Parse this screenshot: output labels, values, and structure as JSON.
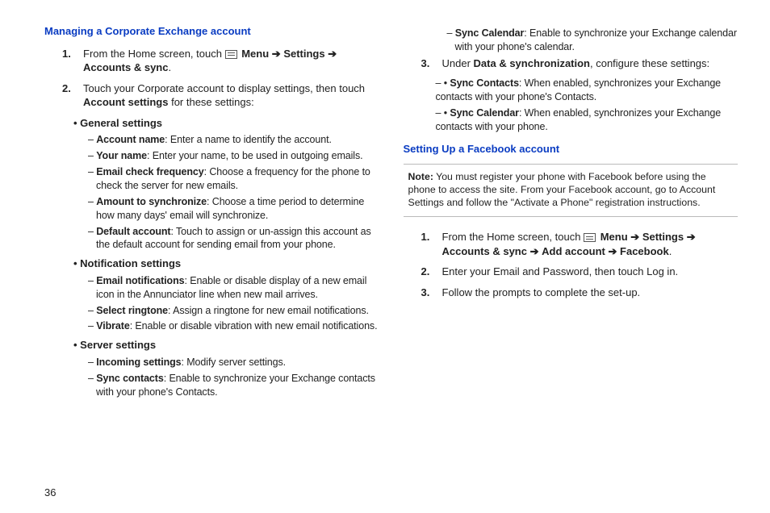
{
  "leftCol": {
    "heading": "Managing a Corporate Exchange account",
    "step1_pre": "From the Home screen, touch ",
    "step1_menu": "Menu",
    "step1_arrow": " ➔ ",
    "step1_settings": "Settings",
    "step1_arrow2": " ➔ ",
    "step1_accounts": "Accounts & sync",
    "step1_period": ".",
    "step2_a": "Touch your Corporate account to display settings, then touch ",
    "step2_b": "Account settings",
    "step2_c": " for these settings:",
    "general_heading": "General settings",
    "g1_b": "Account name",
    "g1_t": ": Enter a name to identify the account.",
    "g2_b": "Your name",
    "g2_t": ": Enter your name, to be used in outgoing emails.",
    "g3_b": "Email check frequency",
    "g3_t": ": Choose a frequency for the phone to check the server for new emails.",
    "g4_b": "Amount to synchronize",
    "g4_t": ": Choose a time period to determine how many days' email will synchronize.",
    "g5_b": "Default account",
    "g5_t": ": Touch to assign or un-assign this account as the default account for sending email from your phone.",
    "notif_heading": "Notification settings",
    "n1_b": "Email notifications",
    "n1_t": ": Enable or disable display of a new email icon in the Annunciator line when new mail arrives.",
    "n2_b": "Select ringtone",
    "n2_t": ": Assign a ringtone for new email notifications.",
    "n3_b": "Vibrate",
    "n3_t": ": Enable or disable vibration with new email notifications.",
    "server_heading": "Server settings",
    "s1_b": "Incoming settings",
    "s1_t": ": Modify server settings.",
    "s2_b": "Sync contacts",
    "s2_t": ": Enable to synchronize your Exchange contacts with your phone's Contacts."
  },
  "rightCol": {
    "cont1_b": "Sync Calendar",
    "cont1_t": ": Enable to synchronize your Exchange calendar with your phone's calendar.",
    "step3_a": "Under ",
    "step3_b": "Data & synchronization",
    "step3_c": ", configure these settings:",
    "d1_b": "Sync Contacts",
    "d1_t": ": When enabled, synchronizes your Exchange contacts with your phone's Contacts.",
    "d2_b": "Sync Calendar",
    "d2_t": ": When enabled, synchronizes your Exchange contacts with your phone.",
    "fb_heading": "Setting Up a Facebook account",
    "note_label": "Note:",
    "note_text": " You must register your phone with Facebook before using the phone to access the site. From your Facebook account, go to Account Settings and follow the \"Activate a Phone\" registration instructions.",
    "fb1_pre": "From the Home screen, touch ",
    "fb1_menu": "Menu",
    "fb1_arr": " ➔ ",
    "fb1_settings": "Settings",
    "fb1_arr2": " ➔ ",
    "fb1_accounts": "Accounts & sync",
    "fb1_arr3": " ➔ ",
    "fb1_add": "Add account",
    "fb1_arr4": " ➔ ",
    "fb1_fb": "Facebook",
    "fb1_period": ".",
    "fb2": "Enter your Email and Password, then touch Log in.",
    "fb3": "Follow the prompts to complete the set-up."
  },
  "pageNumber": "36",
  "numbers": {
    "one": "1.",
    "two": "2.",
    "three": "3."
  }
}
